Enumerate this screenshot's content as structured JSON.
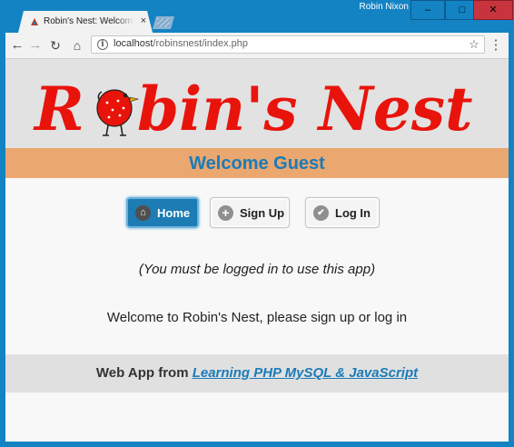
{
  "window": {
    "user_name": "Robin Nixon",
    "controls": {
      "minimize": "–",
      "maximize": "□",
      "close": "✕"
    }
  },
  "tab": {
    "title": "Robin's Nest: Welcome Guest",
    "close": "×"
  },
  "toolbar": {
    "back": "←",
    "forward": "→",
    "reload": "↻",
    "home": "⌂",
    "url_host": "localhost",
    "url_path": "/robinsnest/index.php",
    "star": "☆",
    "menu": "⋮"
  },
  "page": {
    "logo_text_left": "R",
    "logo_text_right": "bin's Nest",
    "welcome": "Welcome Guest",
    "nav": {
      "home": "Home",
      "signup": "Sign Up",
      "login": "Log In"
    },
    "notice": "(You must be logged in to use this app)",
    "message": "Welcome to Robin's Nest, please sign up or log in",
    "footer_prefix": "Web App from ",
    "footer_link": "Learning PHP MySQL & JavaScript"
  },
  "colors": {
    "chrome": "#1383c4",
    "logo": "#e8140c",
    "welcome_bar": "#eaa76f",
    "accent_blue": "#1b7bb8",
    "close_button": "#c8343e"
  },
  "icons": {
    "home": "house-icon",
    "signup": "plus-circle-icon",
    "login": "check-circle-icon"
  }
}
